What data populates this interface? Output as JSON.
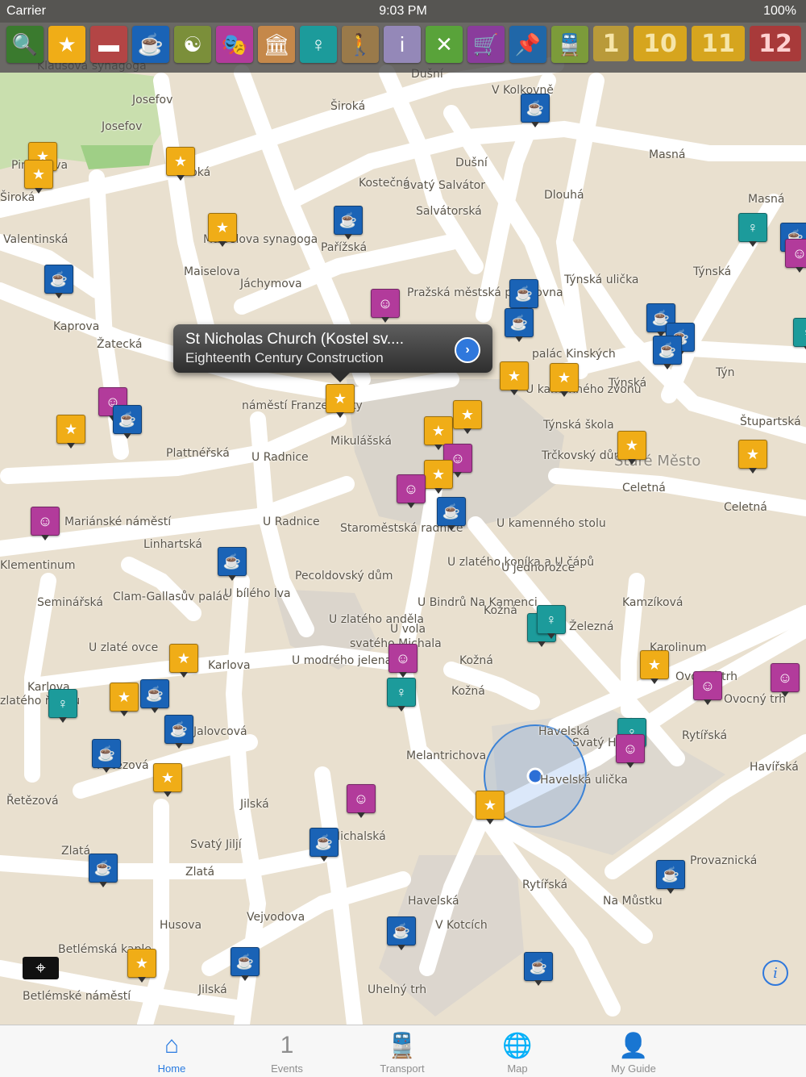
{
  "status": {
    "carrier": "Carrier",
    "time": "9:03 PM",
    "battery": "100%"
  },
  "filters": [
    {
      "name": "search-icon",
      "glyph": "🔍",
      "color": "#3a7a2e"
    },
    {
      "name": "sights-icon",
      "glyph": "★",
      "color": "#f0ad17"
    },
    {
      "name": "hotel-bed-icon",
      "glyph": "▬",
      "color": "#b34545"
    },
    {
      "name": "coffee-cup-icon",
      "glyph": "☕",
      "color": "#1a63b6"
    },
    {
      "name": "yin-yang-icon",
      "glyph": "☯",
      "color": "#7b8f3a"
    },
    {
      "name": "theatre-masks-icon",
      "glyph": "🎭",
      "color": "#b23b9b"
    },
    {
      "name": "museum-icon",
      "glyph": "🏛",
      "color": "#c5884a"
    },
    {
      "name": "nightlife-dancer-icon",
      "glyph": "♀",
      "color": "#1c9b9b"
    },
    {
      "name": "hiker-icon",
      "glyph": "🚶",
      "color": "#9a7a4a"
    },
    {
      "name": "info-icon",
      "glyph": "i",
      "color": "#9488b8"
    },
    {
      "name": "restaurant-cutlery-icon",
      "glyph": "✕",
      "color": "#59a33a"
    },
    {
      "name": "shopping-cart-icon",
      "glyph": "🛒",
      "color": "#8a3c9c"
    },
    {
      "name": "map-pin-icon",
      "glyph": "📌",
      "color": "#2067a8"
    },
    {
      "name": "tram-icon",
      "glyph": "🚆",
      "color": "#7c9b3a"
    }
  ],
  "days": [
    "1",
    "10",
    "11",
    "12"
  ],
  "callout": {
    "title": "St Nicholas Church (Kostel sv....",
    "subtitle": "Eighteenth Century Construction"
  },
  "district": "Staré Město",
  "streets": [
    [
      "Klausova synagoga",
      46,
      75
    ],
    [
      "Josefov",
      164,
      117
    ],
    [
      "Josefov",
      126,
      150
    ],
    [
      "Široká",
      410,
      125
    ],
    [
      "Dušní",
      510,
      85
    ],
    [
      "V Kolkovně",
      610,
      105
    ],
    [
      "Masná",
      805,
      185
    ],
    [
      "Masná",
      928,
      240
    ],
    [
      "Svatý Salvátor",
      500,
      223
    ],
    [
      "Salvátorská",
      516,
      255
    ],
    [
      "Dušní",
      565,
      195
    ],
    [
      "Dlouhá",
      675,
      235
    ],
    [
      "Kostečná",
      445,
      220
    ],
    [
      "Široká",
      218,
      207
    ],
    [
      "Pinkasova",
      14,
      198
    ],
    [
      "Široká",
      0,
      238
    ],
    [
      "Maiselova synagoga",
      252,
      290
    ],
    [
      "Maiselova",
      228,
      330
    ],
    [
      "Jáchymova",
      298,
      345
    ],
    [
      "Pařížská",
      398,
      300
    ],
    [
      "Valentinská",
      4,
      290
    ],
    [
      "Kaprova",
      66,
      398
    ],
    [
      "Žatecká",
      120,
      420
    ],
    [
      "Pražská městská pojišťovna",
      505,
      356
    ],
    [
      "Týnská ulička",
      700,
      340
    ],
    [
      "Týnská",
      860,
      330
    ],
    [
      "palác Kinských",
      660,
      432
    ],
    [
      "Týnská",
      755,
      468
    ],
    [
      "Týn",
      888,
      455
    ],
    [
      "Štupartská",
      918,
      516
    ],
    [
      "U kamenného zvonu",
      652,
      476
    ],
    [
      "Týnská škola",
      674,
      520
    ],
    [
      "Trčkovský dům",
      672,
      558
    ],
    [
      "Celetná",
      772,
      598
    ],
    [
      "Celetná",
      898,
      622
    ],
    [
      "náměstí Franze Kafky",
      300,
      496
    ],
    [
      "Plattnéřská",
      206,
      555
    ],
    [
      "Mikulášská",
      410,
      540
    ],
    [
      "U Radnice",
      312,
      560
    ],
    [
      "Staroměstská radnice",
      422,
      648
    ],
    [
      "U kamenného stolu",
      616,
      642
    ],
    [
      "Mariánské náměstí",
      80,
      640
    ],
    [
      "Linhartská",
      178,
      668
    ],
    [
      "Klementinum",
      0,
      694
    ],
    [
      "U Radnice",
      326,
      640
    ],
    [
      "Pecoldovský dům",
      366,
      707
    ],
    [
      "U zlatého koníka a U čápů",
      555,
      690
    ],
    [
      "U jednorožce",
      622,
      697
    ],
    [
      "Clam-Gallasův palác",
      140,
      733
    ],
    [
      "U bílého lva",
      278,
      729
    ],
    [
      "U Bindrů Na Kamenci",
      518,
      740
    ],
    [
      "U zlatého anděla",
      408,
      761
    ],
    [
      "U vola",
      484,
      773
    ],
    [
      "svatého Michala",
      434,
      791
    ],
    [
      "Kamzíková",
      772,
      740
    ],
    [
      "Železná",
      706,
      770
    ],
    [
      "Karolinum",
      806,
      796
    ],
    [
      "Seminářská",
      46,
      740
    ],
    [
      "U zlaté ovce",
      110,
      796
    ],
    [
      "U modrého jelena",
      362,
      812
    ],
    [
      "Karlova",
      258,
      818
    ],
    [
      "Kožná",
      600,
      750
    ],
    [
      "Kožná",
      570,
      812
    ],
    [
      "Kožná",
      560,
      850
    ],
    [
      "Karlova",
      34,
      845
    ],
    [
      "zlatého řebíku",
      0,
      862
    ],
    [
      "Ovocný trh",
      838,
      832
    ],
    [
      "Ovocný trh",
      898,
      860
    ],
    [
      "Havelská",
      668,
      900
    ],
    [
      "Svatý Havel",
      710,
      914
    ],
    [
      "Havelská ulička",
      670,
      960
    ],
    [
      "Rytířská",
      846,
      905
    ],
    [
      "Havířská",
      930,
      944
    ],
    [
      "Jalovcová",
      240,
      900
    ],
    [
      "Řetězová",
      120,
      942
    ],
    [
      "Řetězová",
      8,
      986
    ],
    [
      "Melantrichova",
      504,
      930
    ],
    [
      "Jilská",
      298,
      990
    ],
    [
      "Michalská",
      410,
      1030
    ],
    [
      "Zlatá",
      76,
      1048
    ],
    [
      "Svatý Jiljí",
      236,
      1040
    ],
    [
      "Zlatá",
      230,
      1074
    ],
    [
      "Husova",
      198,
      1140
    ],
    [
      "Vejvodova",
      306,
      1130
    ],
    [
      "Provaznická",
      856,
      1060
    ],
    [
      "Havelská",
      506,
      1110
    ],
    [
      "V Kotcích",
      540,
      1140
    ],
    [
      "Rytířská",
      648,
      1090
    ],
    [
      "Na Můstku",
      748,
      1110
    ],
    [
      "Betlémská kaple",
      72,
      1170
    ],
    [
      "Betlémské náměstí",
      28,
      1228
    ],
    [
      "Jilská",
      246,
      1220
    ],
    [
      "Uhelný trh",
      456,
      1220
    ]
  ],
  "pins": [
    [
      "attr",
      35,
      176
    ],
    [
      "attr",
      30,
      198
    ],
    [
      "attr",
      206,
      182
    ],
    [
      "cafe",
      646,
      116
    ],
    [
      "cafe",
      414,
      255
    ],
    [
      "attr",
      258,
      264
    ],
    [
      "night",
      916,
      264
    ],
    [
      "cafe",
      968,
      276
    ],
    [
      "thea",
      974,
      296
    ],
    [
      "cafe",
      55,
      328
    ],
    [
      "thea",
      460,
      358
    ],
    [
      "cafe",
      632,
      346
    ],
    [
      "cafe",
      626,
      382
    ],
    [
      "cafe",
      802,
      376
    ],
    [
      "cafe",
      826,
      400
    ],
    [
      "cafe",
      810,
      416
    ],
    [
      "night",
      984,
      394
    ],
    [
      "attr",
      404,
      476
    ],
    [
      "attr",
      620,
      448
    ],
    [
      "attr",
      682,
      450
    ],
    [
      "thea",
      122,
      480
    ],
    [
      "cafe",
      140,
      502
    ],
    [
      "attr",
      70,
      514
    ],
    [
      "attr",
      526,
      516
    ],
    [
      "attr",
      562,
      496
    ],
    [
      "thea",
      550,
      550
    ],
    [
      "attr",
      526,
      570
    ],
    [
      "thea",
      492,
      588
    ],
    [
      "attr",
      766,
      534
    ],
    [
      "attr",
      916,
      545
    ],
    [
      "cafe",
      542,
      616
    ],
    [
      "thea",
      38,
      628
    ],
    [
      "cafe",
      270,
      678
    ],
    [
      "night",
      654,
      760
    ],
    [
      "night",
      666,
      750
    ],
    [
      "attr",
      210,
      798
    ],
    [
      "thea",
      482,
      798
    ],
    [
      "attr",
      136,
      846
    ],
    [
      "cafe",
      174,
      842
    ],
    [
      "night",
      60,
      854
    ],
    [
      "night",
      480,
      840
    ],
    [
      "attr",
      794,
      806
    ],
    [
      "thea",
      860,
      832
    ],
    [
      "thea",
      956,
      822
    ],
    [
      "cafe",
      204,
      886
    ],
    [
      "night",
      766,
      890
    ],
    [
      "thea",
      764,
      910
    ],
    [
      "cafe",
      114,
      916
    ],
    [
      "attr",
      190,
      946
    ],
    [
      "thea",
      430,
      972
    ],
    [
      "attr",
      590,
      980
    ],
    [
      "cafe",
      384,
      1026
    ],
    [
      "cafe",
      110,
      1058
    ],
    [
      "cafe",
      814,
      1066
    ],
    [
      "cafe",
      480,
      1136
    ],
    [
      "attr",
      158,
      1176
    ],
    [
      "cafe",
      286,
      1174
    ],
    [
      "cafe",
      650,
      1180
    ]
  ],
  "tabs": [
    {
      "label": "Home",
      "icon": "home-icon",
      "glyph": "⌂",
      "active": true
    },
    {
      "label": "Events",
      "icon": "calendar-icon",
      "glyph": "1",
      "active": false
    },
    {
      "label": "Transport",
      "icon": "train-icon",
      "glyph": "🚆",
      "active": false
    },
    {
      "label": "Map",
      "icon": "globe-icon",
      "glyph": "🌐",
      "active": false
    },
    {
      "label": "My Guide",
      "icon": "person-icon",
      "glyph": "👤",
      "active": false
    }
  ]
}
